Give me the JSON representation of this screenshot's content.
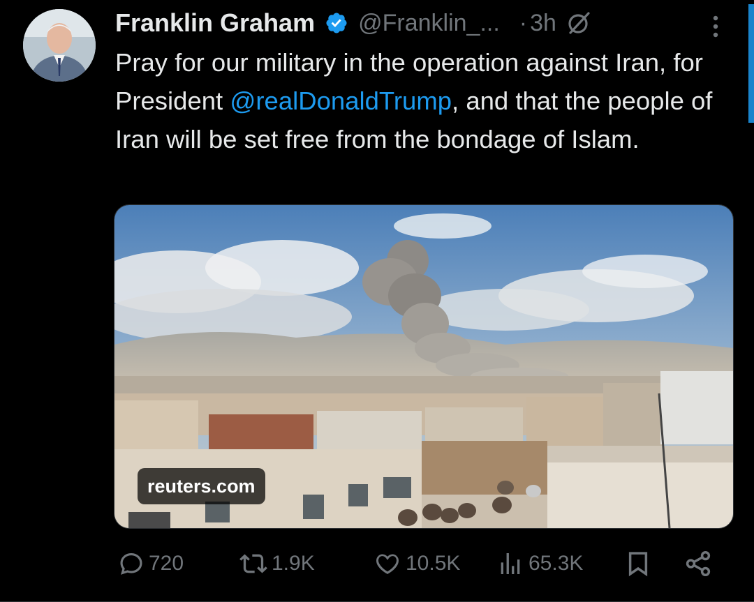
{
  "tweet": {
    "author_name": "Franklin Graham",
    "handle": "@Franklin_...",
    "separator": "·",
    "time": "3h",
    "text_before": "Pray for our military in the operation against Iran, for President ",
    "mention": "@realDonaldTrump",
    "text_after": ", and that the people of Iran will be set free from the bondage of Islam.",
    "media_source": "reuters.com"
  },
  "actions": {
    "replies": "720",
    "reposts": "1.9K",
    "likes": "10.5K",
    "views": "65.3K"
  },
  "colors": {
    "background": "#000000",
    "text": "#e7e9ea",
    "secondary": "#71767b",
    "accent": "#1d9bf0"
  },
  "icons": [
    "verified-badge-icon",
    "grok-icon",
    "more-icon",
    "reply-icon",
    "repost-icon",
    "like-icon",
    "views-icon",
    "bookmark-icon",
    "share-icon"
  ]
}
